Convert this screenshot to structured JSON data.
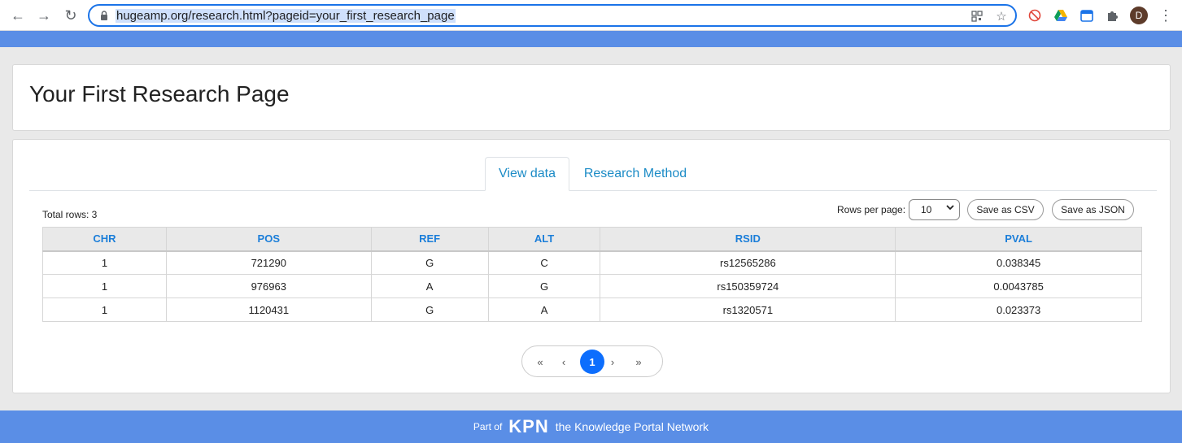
{
  "browser": {
    "url": "hugeamp.org/research.html?pageid=your_first_research_page",
    "avatar_letter": "D",
    "back_icon": "←",
    "forward_icon": "→",
    "reload_icon": "↻",
    "menu_icon": "⋮"
  },
  "page": {
    "title": "Your First Research Page"
  },
  "tabs": [
    {
      "label": "View data",
      "active": true
    },
    {
      "label": "Research Method",
      "active": false
    }
  ],
  "toolbar": {
    "total_rows": "Total rows: 3",
    "rows_per_page_label": "Rows per page:",
    "rows_per_page_value": "10",
    "save_csv": "Save as CSV",
    "save_json": "Save as JSON"
  },
  "table": {
    "columns": [
      "CHR",
      "POS",
      "REF",
      "ALT",
      "RSID",
      "PVAL"
    ],
    "rows": [
      [
        "1",
        "721290",
        "G",
        "C",
        "rs12565286",
        "0.038345"
      ],
      [
        "1",
        "976963",
        "A",
        "G",
        "rs150359724",
        "0.0043785"
      ],
      [
        "1",
        "1120431",
        "G",
        "A",
        "rs1320571",
        "0.023373"
      ]
    ]
  },
  "pagination": {
    "first": "«",
    "prev": "‹",
    "current": "1",
    "next": "›",
    "last": "»"
  },
  "footer": {
    "part_of": "Part of",
    "logo_text": "KPN",
    "network": "the Knowledge Portal Network"
  },
  "colors": {
    "brand_bar": "#5a8ee6",
    "link": "#1b8bc6",
    "header_text": "#1b7ed9",
    "page_active": "#0d6efd"
  }
}
